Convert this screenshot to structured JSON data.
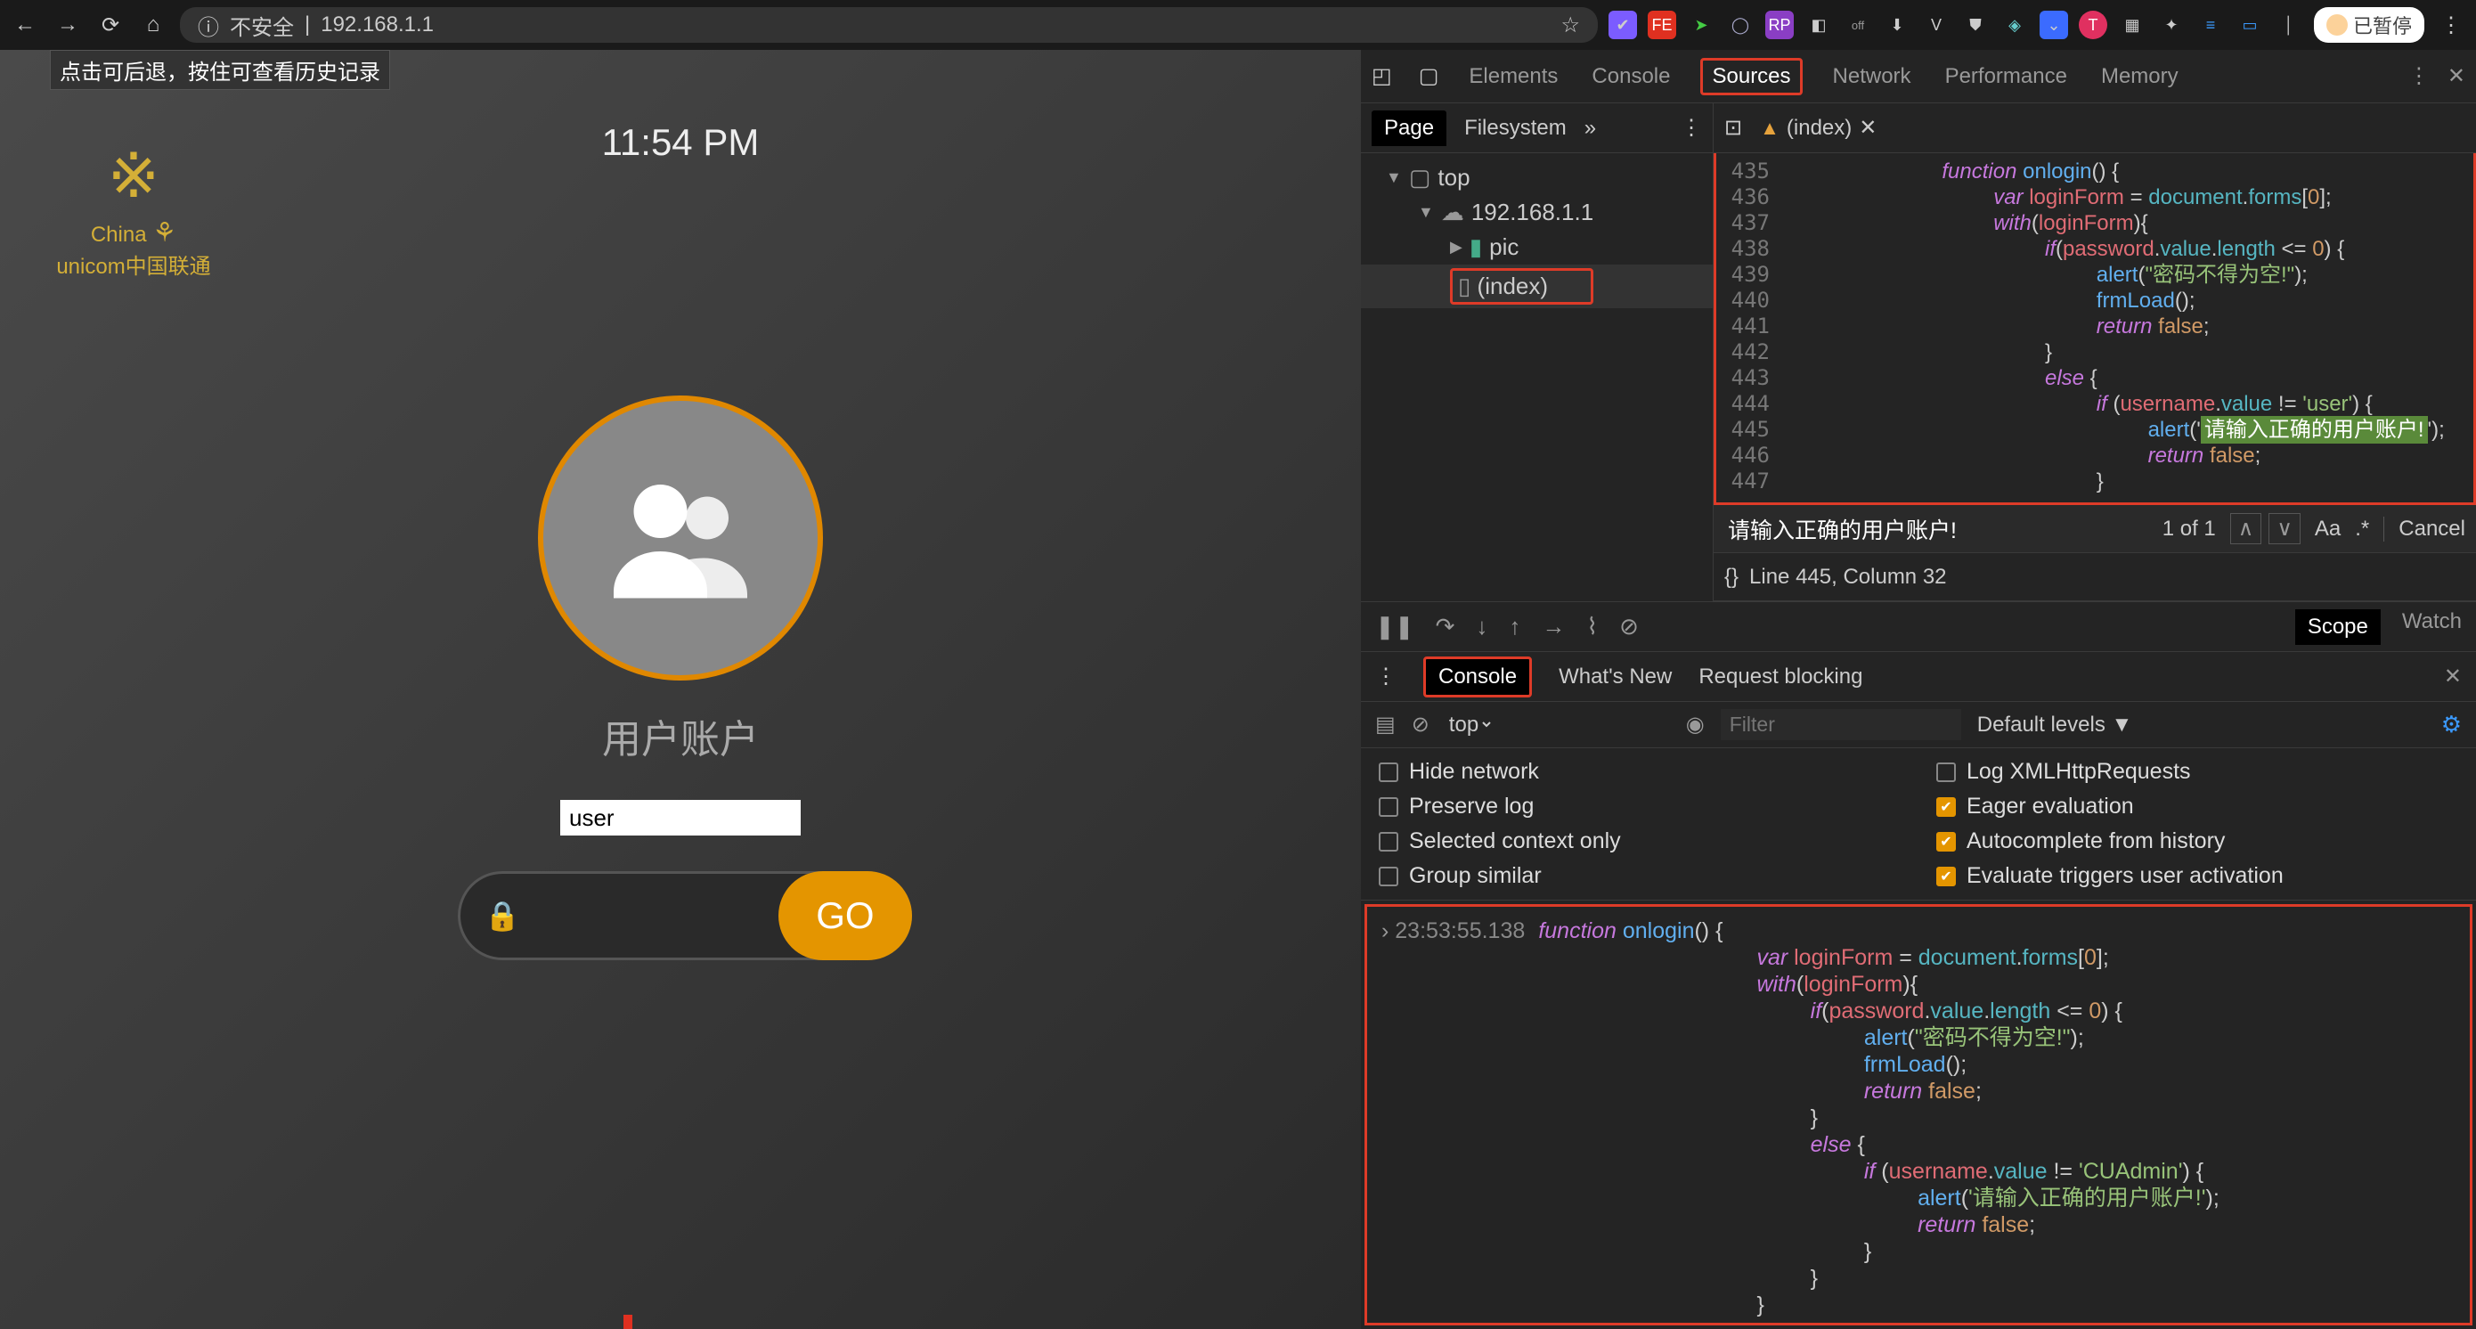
{
  "browser": {
    "insecure": "不安全",
    "address": "192.168.1.1",
    "tooltip": "点击可后退，按住可查看历史记录",
    "paused": "已暂停"
  },
  "page": {
    "logo_brand": "China",
    "logo_sub": "unicom中国联通",
    "time": "11:54 PM",
    "user_label": "用户账户",
    "username": "user",
    "go": "GO"
  },
  "devtools": {
    "tabs": {
      "elements": "Elements",
      "console": "Console",
      "sources": "Sources",
      "network": "Network",
      "performance": "Performance",
      "memory": "Memory"
    },
    "nav": {
      "page": "Page",
      "filesystem": "Filesystem"
    },
    "tree": {
      "top": "top",
      "host": "192.168.1.1",
      "pic": "pic",
      "index": "(index)"
    },
    "code_tab": "(index)",
    "gutter": [
      "435",
      "436",
      "437",
      "438",
      "439",
      "440",
      "441",
      "442",
      "443",
      "444",
      "445",
      "446",
      "447"
    ],
    "code_lines": [
      {
        "ind": 3,
        "seg": [
          {
            "c": "kw",
            "t": "function"
          },
          {
            "c": "op",
            "t": " "
          },
          {
            "c": "fn",
            "t": "onlogin"
          },
          {
            "c": "op",
            "t": "() {"
          }
        ]
      },
      {
        "ind": 4,
        "seg": [
          {
            "c": "kw",
            "t": "var"
          },
          {
            "c": "op",
            "t": " "
          },
          {
            "c": "var",
            "t": "loginForm"
          },
          {
            "c": "op",
            "t": " = "
          },
          {
            "c": "prop",
            "t": "document"
          },
          {
            "c": "op",
            "t": "."
          },
          {
            "c": "prop",
            "t": "forms"
          },
          {
            "c": "op",
            "t": "["
          },
          {
            "c": "num",
            "t": "0"
          },
          {
            "c": "op",
            "t": "];"
          }
        ]
      },
      {
        "ind": 4,
        "seg": [
          {
            "c": "kw",
            "t": "with"
          },
          {
            "c": "op",
            "t": "("
          },
          {
            "c": "var",
            "t": "loginForm"
          },
          {
            "c": "op",
            "t": "){"
          }
        ]
      },
      {
        "ind": 5,
        "seg": [
          {
            "c": "kw",
            "t": "if"
          },
          {
            "c": "op",
            "t": "("
          },
          {
            "c": "var",
            "t": "password"
          },
          {
            "c": "op",
            "t": "."
          },
          {
            "c": "prop",
            "t": "value"
          },
          {
            "c": "op",
            "t": "."
          },
          {
            "c": "prop",
            "t": "length"
          },
          {
            "c": "op",
            "t": " <= "
          },
          {
            "c": "num",
            "t": "0"
          },
          {
            "c": "op",
            "t": ") {"
          }
        ]
      },
      {
        "ind": 6,
        "seg": [
          {
            "c": "fn",
            "t": "alert"
          },
          {
            "c": "op",
            "t": "("
          },
          {
            "c": "str",
            "t": "\"密码不得为空!\""
          },
          {
            "c": "op",
            "t": ");"
          }
        ]
      },
      {
        "ind": 6,
        "seg": [
          {
            "c": "fn",
            "t": "frmLoad"
          },
          {
            "c": "op",
            "t": "();"
          }
        ]
      },
      {
        "ind": 6,
        "seg": [
          {
            "c": "kw",
            "t": "return"
          },
          {
            "c": "op",
            "t": " "
          },
          {
            "c": "num",
            "t": "false"
          },
          {
            "c": "op",
            "t": ";"
          }
        ]
      },
      {
        "ind": 5,
        "seg": [
          {
            "c": "op",
            "t": "}"
          }
        ]
      },
      {
        "ind": 5,
        "seg": [
          {
            "c": "kw",
            "t": "else"
          },
          {
            "c": "op",
            "t": " {"
          }
        ]
      },
      {
        "ind": 6,
        "seg": [
          {
            "c": "kw",
            "t": "if"
          },
          {
            "c": "op",
            "t": " ("
          },
          {
            "c": "var",
            "t": "username"
          },
          {
            "c": "op",
            "t": "."
          },
          {
            "c": "prop",
            "t": "value"
          },
          {
            "c": "op",
            "t": " != "
          },
          {
            "c": "str",
            "t": "'user'"
          },
          {
            "c": "op",
            "t": ") {"
          }
        ]
      },
      {
        "ind": 7,
        "seg": [
          {
            "c": "fn",
            "t": "alert"
          },
          {
            "c": "op",
            "t": "('"
          },
          {
            "c": "hl-str",
            "t": "请输入正确的用户账户!"
          },
          {
            "c": "op",
            "t": "');"
          }
        ]
      },
      {
        "ind": 7,
        "seg": [
          {
            "c": "kw",
            "t": "return"
          },
          {
            "c": "op",
            "t": " "
          },
          {
            "c": "num",
            "t": "false"
          },
          {
            "c": "op",
            "t": ";"
          }
        ]
      },
      {
        "ind": 6,
        "seg": [
          {
            "c": "op",
            "t": "}"
          }
        ]
      }
    ],
    "find": {
      "value": "请输入正确的用户账户!",
      "count": "1 of 1",
      "aa": "Aa",
      "re": ".*",
      "cancel": "Cancel"
    },
    "status": "Line 445, Column 32",
    "scope": "Scope",
    "watch": "Watch",
    "drawer": {
      "console": "Console",
      "whatsnew": "What's New",
      "reqblock": "Request blocking"
    },
    "console": {
      "ctx": "top",
      "filter_ph": "Filter",
      "levels": "Default levels ▼",
      "opts": {
        "hide_net": "Hide network",
        "preserve": "Preserve log",
        "selctx": "Selected context only",
        "group": "Group similar",
        "logxhr": "Log XMLHttpRequests",
        "eager": "Eager evaluation",
        "auto": "Autocomplete from history",
        "evaltrig": "Evaluate triggers user activation"
      },
      "ts": "23:53:55.138",
      "lines": [
        {
          "ind": 0,
          "seg": [
            {
              "c": "kw",
              "t": "function"
            },
            {
              "c": "op",
              "t": " "
            },
            {
              "c": "fn",
              "t": "onlogin"
            },
            {
              "c": "op",
              "t": "() {"
            }
          ]
        },
        {
          "ind": 3,
          "seg": [
            {
              "c": "kw",
              "t": "var"
            },
            {
              "c": "op",
              "t": " "
            },
            {
              "c": "var",
              "t": "loginForm"
            },
            {
              "c": "op",
              "t": " = "
            },
            {
              "c": "prop",
              "t": "document"
            },
            {
              "c": "op",
              "t": "."
            },
            {
              "c": "prop",
              "t": "forms"
            },
            {
              "c": "op",
              "t": "["
            },
            {
              "c": "num",
              "t": "0"
            },
            {
              "c": "op",
              "t": "];"
            }
          ]
        },
        {
          "ind": 3,
          "seg": [
            {
              "c": "kw",
              "t": "with"
            },
            {
              "c": "op",
              "t": "("
            },
            {
              "c": "var",
              "t": "loginForm"
            },
            {
              "c": "op",
              "t": "){"
            }
          ]
        },
        {
          "ind": 4,
          "seg": [
            {
              "c": "kw",
              "t": "if"
            },
            {
              "c": "op",
              "t": "("
            },
            {
              "c": "var",
              "t": "password"
            },
            {
              "c": "op",
              "t": "."
            },
            {
              "c": "prop",
              "t": "value"
            },
            {
              "c": "op",
              "t": "."
            },
            {
              "c": "prop",
              "t": "length"
            },
            {
              "c": "op",
              "t": " <= "
            },
            {
              "c": "num",
              "t": "0"
            },
            {
              "c": "op",
              "t": ") {"
            }
          ]
        },
        {
          "ind": 5,
          "seg": [
            {
              "c": "fn",
              "t": "alert"
            },
            {
              "c": "op",
              "t": "("
            },
            {
              "c": "str",
              "t": "\"密码不得为空!\""
            },
            {
              "c": "op",
              "t": ");"
            }
          ]
        },
        {
          "ind": 5,
          "seg": [
            {
              "c": "fn",
              "t": "frmLoad"
            },
            {
              "c": "op",
              "t": "();"
            }
          ]
        },
        {
          "ind": 5,
          "seg": [
            {
              "c": "kw",
              "t": "return"
            },
            {
              "c": "op",
              "t": " "
            },
            {
              "c": "num",
              "t": "false"
            },
            {
              "c": "op",
              "t": ";"
            }
          ]
        },
        {
          "ind": 4,
          "seg": [
            {
              "c": "op",
              "t": "}"
            }
          ]
        },
        {
          "ind": 4,
          "seg": [
            {
              "c": "kw",
              "t": "else"
            },
            {
              "c": "op",
              "t": " {"
            }
          ]
        },
        {
          "ind": 5,
          "seg": [
            {
              "c": "kw",
              "t": "if"
            },
            {
              "c": "op",
              "t": " ("
            },
            {
              "c": "var",
              "t": "username"
            },
            {
              "c": "op",
              "t": "."
            },
            {
              "c": "prop",
              "t": "value"
            },
            {
              "c": "op",
              "t": " != "
            },
            {
              "c": "str",
              "t": "'CUAdmin'"
            },
            {
              "c": "op",
              "t": ") {"
            }
          ]
        },
        {
          "ind": 6,
          "seg": [
            {
              "c": "fn",
              "t": "alert"
            },
            {
              "c": "op",
              "t": "("
            },
            {
              "c": "str",
              "t": "'请输入正确的用户账户!'"
            },
            {
              "c": "op",
              "t": ");"
            }
          ]
        },
        {
          "ind": 6,
          "seg": [
            {
              "c": "kw",
              "t": "return"
            },
            {
              "c": "op",
              "t": " "
            },
            {
              "c": "num",
              "t": "false"
            },
            {
              "c": "op",
              "t": ";"
            }
          ]
        },
        {
          "ind": 5,
          "seg": [
            {
              "c": "op",
              "t": "}"
            }
          ]
        },
        {
          "ind": 4,
          "seg": [
            {
              "c": "op",
              "t": "}"
            }
          ]
        },
        {
          "ind": 3,
          "seg": [
            {
              "c": "op",
              "t": "}"
            }
          ]
        }
      ]
    }
  }
}
